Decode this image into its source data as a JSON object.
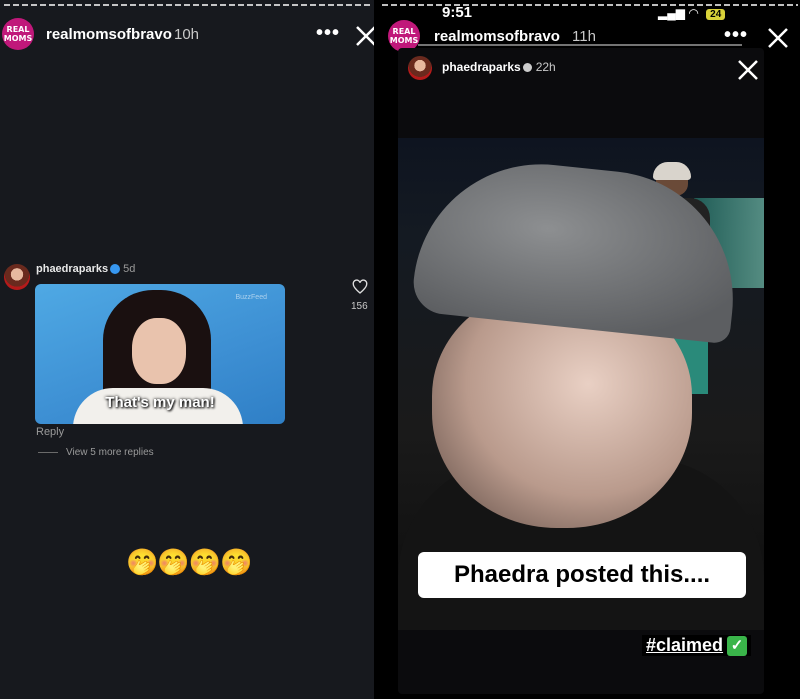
{
  "left_story": {
    "account": "realmomsofbravo",
    "time": "10h",
    "avatar_line1": "REAL",
    "avatar_line2": "MOMS",
    "more_icon": "ellipsis-icon",
    "close_icon": "close-icon",
    "comment": {
      "user": "phaedraparks",
      "time": "5d",
      "gif_caption": "That's my man!",
      "gif_watermark": "BuzzFeed",
      "reply_label": "Reply",
      "view_replies": "View 5 more replies",
      "likes": "156"
    },
    "emojis": "🤭🤭🤭🤭"
  },
  "right_story": {
    "status_time": "9:51",
    "battery": "24",
    "account": "realmomsofbravo",
    "time": "11h",
    "avatar_line1": "REAL",
    "avatar_line2": "MOMS",
    "inner_post": {
      "user": "phaedraparks",
      "time": "22h",
      "banner": "Phaedra posted this....",
      "hashtag": "#claimed",
      "check_emoji": "✓"
    }
  }
}
